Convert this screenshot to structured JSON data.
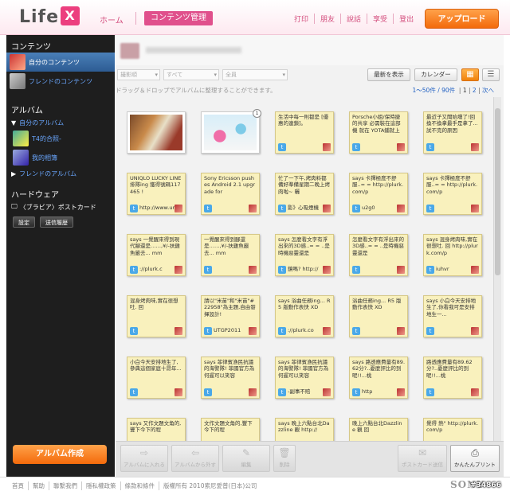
{
  "header": {
    "logo_text": "Life",
    "logo_mark": "X",
    "nav_home": "ホーム",
    "nav_contents": "コンテンツ管理",
    "links": [
      "打印",
      "朋友",
      "說話",
      "享受",
      "登出"
    ],
    "upload_label": "アップロード"
  },
  "sidebar": {
    "contents_heading": "コンテンツ",
    "my_contents": "自分のコンテンツ",
    "friends_contents": "フレンドのコンテンツ",
    "album_heading": "アルバム",
    "album_tree_label": "自分のアルバム",
    "album_item_1": "T4的合照-",
    "album_item_2": "我的相簿",
    "album_item_3": "フレンドのアルバム",
    "hardware_heading": "ハードウェア",
    "hardware_item": "〈ブラビア〉ポストカード",
    "settings_label": "設定",
    "history_label": "送信履歴",
    "create_album_label": "アルバム作成"
  },
  "main": {
    "filter_1": "撮影順",
    "filter_2": "すべて",
    "filter_3": "全員",
    "btn_latest": "最新を表示",
    "btn_calendar": "カレンダー",
    "view_grid_icon": "grid-icon",
    "view_list_icon": "list-icon",
    "hint": "ドラッグ＆ドロップでアルバムに整理することができます。",
    "pager_range": "1〜50件 / 90件",
    "pager_pages": [
      "1",
      "2"
    ],
    "pager_next": "次へ"
  },
  "cards": [
    {
      "type": "photo",
      "style": "p1"
    },
    {
      "type": "photo",
      "style": "p2",
      "badge": "1"
    },
    {
      "type": "text",
      "text": "生活中每一則都是 [優惠的連鎖]。",
      "foot": ""
    },
    {
      "type": "text",
      "text": "Porsche小姐/保時捷的共享 必需裝在這部機 就在 YOTA鋪就上",
      "foot": ""
    },
    {
      "type": "text",
      "text": "最近子又聞始壞了!回 換不換拿最手是拿了...試不完的原因",
      "foot": ""
    },
    {
      "type": "text",
      "text": "UNIQLO LUCKY LINE 排隊ing 獲得號碼117465 !",
      "foot": "http://www.uniq"
    },
    {
      "type": "text",
      "text": "Sony Ericsson pushes Android 2.1 upgrade for",
      "foot": ""
    },
    {
      "type": "text",
      "text": "忙了一下午,烤肉料都備好準備星期二晚上烤肉啦~ 曬",
      "foot": "影》心吸煙機"
    },
    {
      "type": "text",
      "text": "says 卡擇極度不舒服..= = http://plurk.com/p",
      "foot": "u2g0"
    },
    {
      "type": "text",
      "text": "says 卡擇極度不舒服..= = http://plurk.com/p",
      "foot": ""
    },
    {
      "type": "text",
      "text": "says 一覺醒來得到現代腳還是……,¥/-扶雞魚嚴去... mm",
      "foot": "://plurk.c"
    },
    {
      "type": "text",
      "text": "一覺醒來得到腳還是……,¥/-扶雞魚嚴去... mm",
      "foot": ""
    },
    {
      "type": "text",
      "text": "says 怎麼看文字有浮出來的3D感..= = ..是時機惡靈還是",
      "foot": "鏡嗎? http://"
    },
    {
      "type": "text",
      "text": "怎麼看文字有浮出來的3D感..= = ..是時機惡靈還是",
      "foot": ""
    },
    {
      "type": "text",
      "text": "says 混身烤肉味,實在很想吐. 回 http://plurk.com/p",
      "foot": "iuhvr"
    },
    {
      "type": "text",
      "text": "混身烤肉味,實在很想吐. 回",
      "foot": ""
    },
    {
      "type": "text",
      "text": "請以\"米苗\"和\"米苗\"#22958\"為主題,自由發揮設計!",
      "foot": "UTGP2011"
    },
    {
      "type": "text",
      "text": "says 浴曲任務ing... R5 版動作表快 XD",
      "foot": "://plurk.co"
    },
    {
      "type": "text",
      "text": "浴曲任務ing... R5 版動作表快 XD",
      "foot": ""
    },
    {
      "type": "text",
      "text": "says 小白今天安排地生了,你看我可是安排地生一...",
      "foot": ""
    },
    {
      "type": "text",
      "text": "小白今天安排地生了,參典這個家庭十昂年...",
      "foot": ""
    },
    {
      "type": "text",
      "text": "says 菲律賓漁民抗議的海警隊! 菲國官方為何遲可以笑容",
      "foot": ""
    },
    {
      "type": "text",
      "text": "says 菲律賓漁民抗議的海警隊! 菲國官方為何遲可以笑容",
      "foot": "-副事不賠"
    },
    {
      "type": "text",
      "text": "says 路透應費量有89.62分?..憂麼評比的到呢!!...桃",
      "foot": "http"
    },
    {
      "type": "text",
      "text": "路透應費量有89.62分?..憂麼評比的到呢!!...桃",
      "foot": ""
    },
    {
      "type": "text",
      "text": "says 又作文題文角的,豐下今下的程",
      "foot": ""
    },
    {
      "type": "text",
      "text": "文作文題文角的,豐下今下的程",
      "foot": ""
    },
    {
      "type": "text",
      "text": "says 晚上六點台北Dazzline 觀 http://",
      "foot": ""
    },
    {
      "type": "text",
      "text": "晚上六點台北Dazzline 觀 回",
      "foot": ""
    },
    {
      "type": "text",
      "text": "覺得 熱\" http://plurk.com/p",
      "foot": ""
    }
  ],
  "toolbar": {
    "add_to_album": "アルバムに入れる",
    "remove_from_album": "アルバムから外す",
    "edit": "編集",
    "delete": "削除",
    "postcard": "ポストカード送信",
    "print": "かんたんプリント"
  },
  "footer": {
    "links": [
      "首頁",
      "幫助",
      "聯繫我們",
      "隱私權政策",
      "條款和條件",
      "版權所有 2010索尼愛普(日本)公司"
    ],
    "brand": "SONY",
    "watermark": "#34866"
  }
}
